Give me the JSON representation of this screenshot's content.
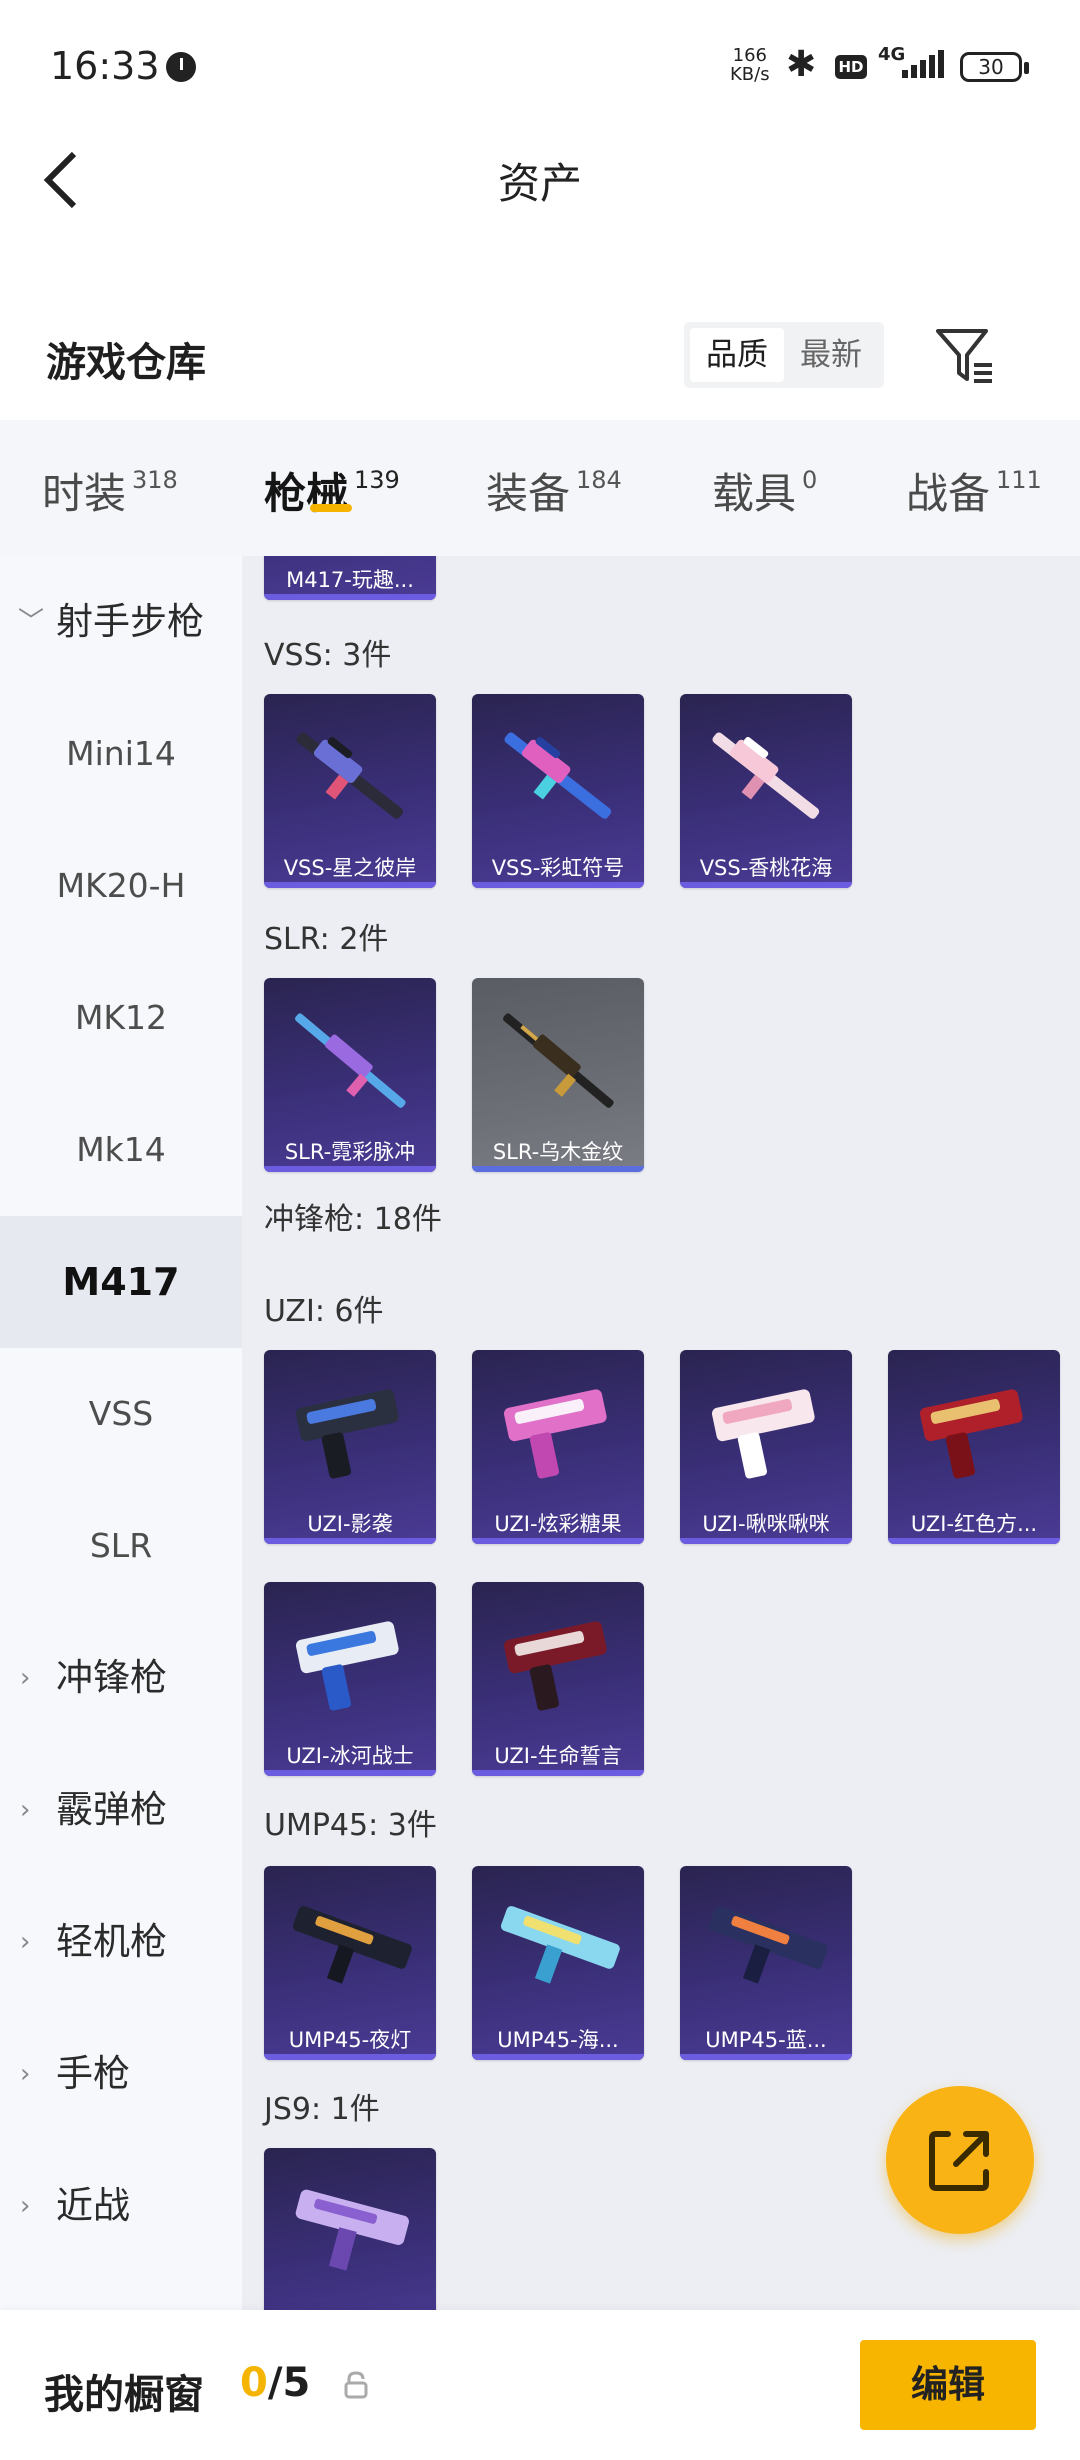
{
  "status_bar": {
    "time": "16:33",
    "net_speed_value": "166",
    "net_speed_unit": "KB/s",
    "hd": "HD",
    "network": "4G",
    "battery": "30"
  },
  "header": {
    "title": "资产"
  },
  "warehouse": {
    "title": "游戏仓库",
    "sort_quality": "品质",
    "sort_newest": "最新"
  },
  "tabs": [
    {
      "label": "时装",
      "count": "318"
    },
    {
      "label": "枪械",
      "count": "139",
      "active": true
    },
    {
      "label": "装备",
      "count": "184"
    },
    {
      "label": "载具",
      "count": "0"
    },
    {
      "label": "战备",
      "count": "111"
    }
  ],
  "sidebar": {
    "category_open": "射手步枪",
    "items": [
      "Mini14",
      "MK20-H",
      "MK12",
      "Mk14",
      "M417",
      "VSS",
      "SLR"
    ],
    "selected": "M417",
    "categories": [
      "冲锋枪",
      "霰弹枪",
      "轻机枪",
      "手枪",
      "近战"
    ]
  },
  "content": {
    "top_partial": "M417-玩趣...",
    "vss": {
      "heading": "VSS: 3件",
      "items": [
        "VSS-星之彼岸",
        "VSS-彩虹符号",
        "VSS-香桃花海"
      ]
    },
    "slr": {
      "heading": "SLR: 2件",
      "items": [
        "SLR-霓彩脉冲",
        "SLR-乌木金纹"
      ]
    },
    "smg_heading": "冲锋枪: 18件",
    "uzi": {
      "heading": "UZI: 6件",
      "items": [
        "UZI-影袭",
        "UZI-炫彩糖果",
        "UZI-啾咪啾咪",
        "UZI-红色方...",
        "UZI-冰河战士",
        "UZI-生命誓言"
      ]
    },
    "ump": {
      "heading": "UMP45: 3件",
      "items": [
        "UMP45-夜灯",
        "UMP45-海...",
        "UMP45-蓝..."
      ]
    },
    "js9": {
      "heading": "JS9: 1件"
    }
  },
  "footer": {
    "label": "我的橱窗",
    "current": "0",
    "total": "/5",
    "edit": "编辑"
  },
  "colors": {
    "accent": "#F7B500",
    "card_purple": "#3A2F78",
    "card_gray": "#6C6E76"
  }
}
